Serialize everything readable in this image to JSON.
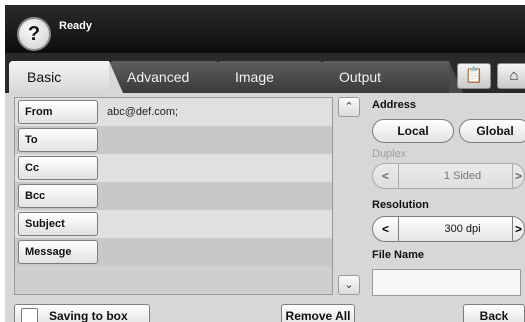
{
  "header": {
    "status": "Ready",
    "help_glyph": "?"
  },
  "tabs": [
    {
      "label": "Basic",
      "active": true
    },
    {
      "label": "Advanced",
      "active": false
    },
    {
      "label": "Image",
      "active": false
    },
    {
      "label": "Output",
      "active": false
    }
  ],
  "toolbar_icons": [
    "clipboard-icon",
    "home-icon"
  ],
  "recipients": [
    {
      "label": "From",
      "value": "abc@def.com;"
    },
    {
      "label": "To",
      "value": ""
    },
    {
      "label": "Cc",
      "value": ""
    },
    {
      "label": "Bcc",
      "value": ""
    },
    {
      "label": "Subject",
      "value": ""
    },
    {
      "label": "Message",
      "value": ""
    }
  ],
  "scroll": {
    "up": "^",
    "down": "v"
  },
  "address": {
    "label": "Address",
    "local": "Local",
    "global": "Global"
  },
  "duplex": {
    "label": "Duplex",
    "value": "1 Sided",
    "enabled": false
  },
  "resolution": {
    "label": "Resolution",
    "value": "300 dpi"
  },
  "filename": {
    "label": "File Name",
    "value": ""
  },
  "footer": {
    "saving": "Saving to box",
    "remove_all": "Remove All",
    "back": "Back"
  }
}
